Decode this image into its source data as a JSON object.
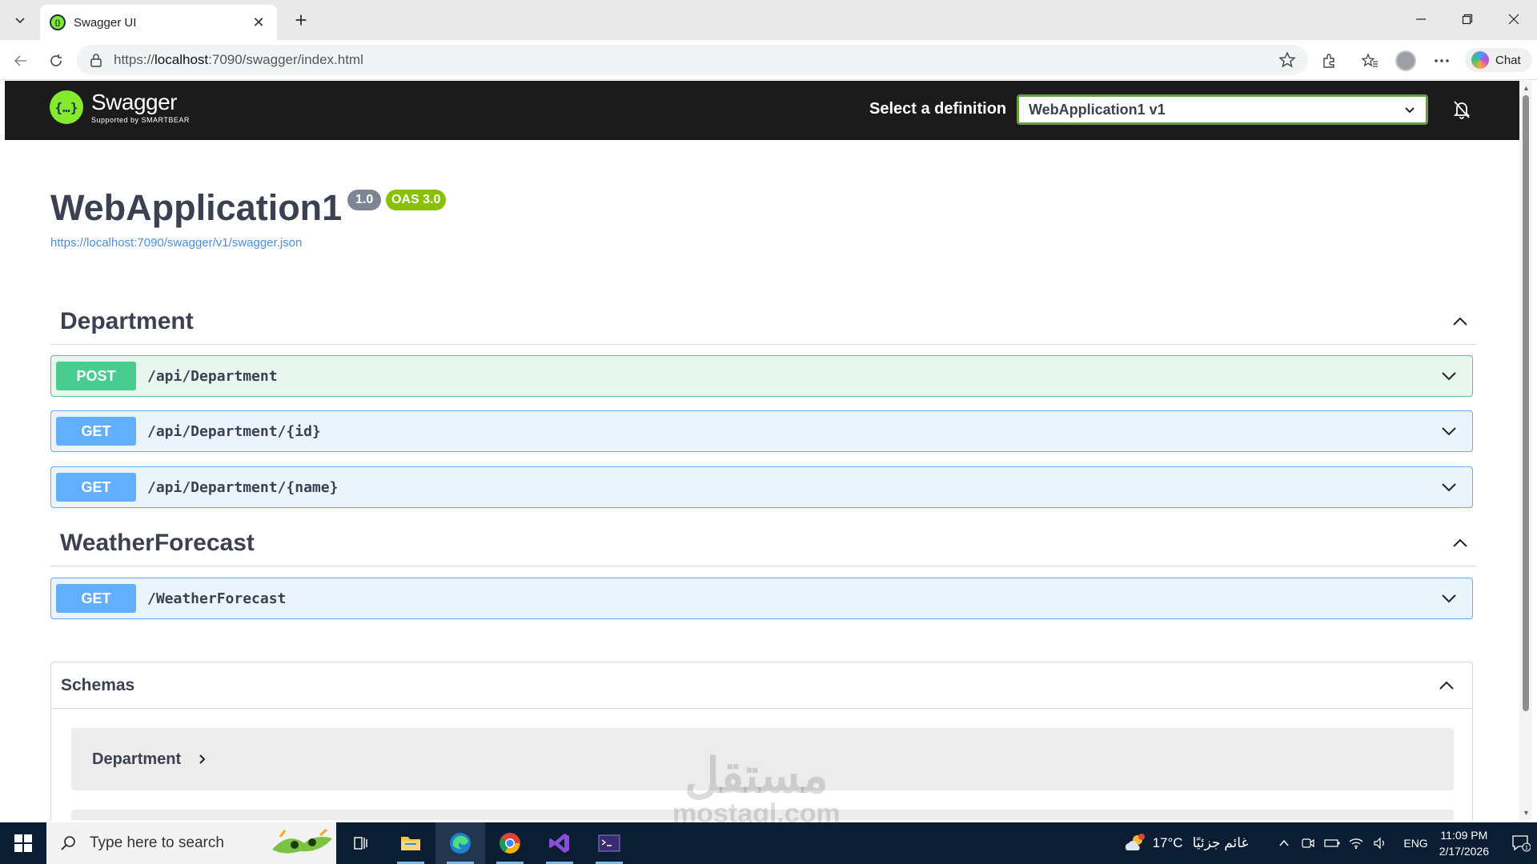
{
  "browser": {
    "tab_title": "Swagger UI",
    "url_prefix": "https://",
    "url_host": "localhost",
    "url_rest": ":7090/swagger/index.html",
    "chat_label": "Chat"
  },
  "swagger": {
    "logo_name": "Swagger",
    "logo_sub": "Supported by SMARTBEAR",
    "select_label": "Select a definition",
    "selected_definition": "WebApplication1 v1",
    "title": "WebApplication1",
    "version": "1.0",
    "oas": "OAS 3.0",
    "spec_link": "https://localhost:7090/swagger/v1/swagger.json",
    "tags": [
      {
        "name": "Department",
        "operations": [
          {
            "method": "POST",
            "path": "/api/Department"
          },
          {
            "method": "GET",
            "path": "/api/Department/{id}"
          },
          {
            "method": "GET",
            "path": "/api/Department/{name}"
          }
        ]
      },
      {
        "name": "WeatherForecast",
        "operations": [
          {
            "method": "GET",
            "path": "/WeatherForecast"
          }
        ]
      }
    ],
    "schemas_title": "Schemas",
    "schemas": [
      "Department"
    ]
  },
  "watermark": {
    "arabic": "مستقل",
    "latin": "mostaql.com"
  },
  "taskbar": {
    "search_placeholder": "Type here to search",
    "weather_temp": "17°C",
    "weather_desc": "غائم جزئيًا",
    "lang": "ENG",
    "time": "11:09 PM",
    "date": "2/17/2026",
    "notification_count": "1"
  },
  "colors": {
    "post": "#49cc90",
    "get": "#61affe",
    "topbar": "#1b1b1b",
    "swagger_green": "#85ea2d",
    "oas_badge": "#89bf04"
  }
}
